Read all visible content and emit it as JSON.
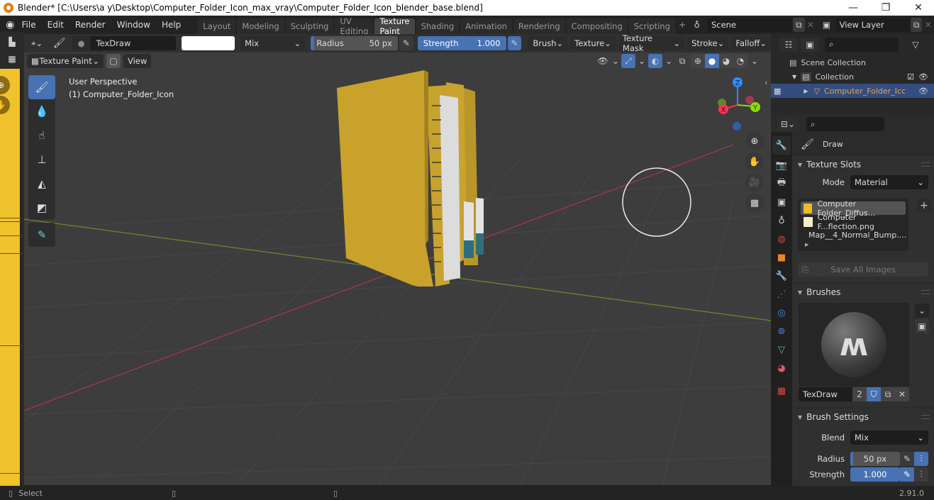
{
  "window": {
    "title": "Blender* [C:\\Users\\a y\\Desktop\\Computer_Folder_Icon_max_vray\\Computer_Folder_Icon_blender_base.blend]",
    "controls": {
      "minimize": "—",
      "maximize": "❐",
      "close": "✕"
    }
  },
  "menu": [
    "File",
    "Edit",
    "Render",
    "Window",
    "Help"
  ],
  "workspaces": [
    {
      "label": "Layout",
      "active": false
    },
    {
      "label": "Modeling",
      "active": false
    },
    {
      "label": "Sculpting",
      "active": false
    },
    {
      "label": "UV Editing",
      "active": false
    },
    {
      "label": "Texture Paint",
      "active": true
    },
    {
      "label": "Shading",
      "active": false
    },
    {
      "label": "Animation",
      "active": false
    },
    {
      "label": "Rendering",
      "active": false
    },
    {
      "label": "Compositing",
      "active": false
    },
    {
      "label": "Scripting",
      "active": false
    }
  ],
  "add_workspace": "+",
  "scene": {
    "label": "Scene"
  },
  "view_layer": {
    "label": "View Layer"
  },
  "tool_header": {
    "brush_name": "TexDraw",
    "color": "#ffffff",
    "blend": "Mix",
    "radius_label": "Radius",
    "radius_value": "50 px",
    "strength_label": "Strength",
    "strength_value": "1.000",
    "menus": [
      "Brush",
      "Texture",
      "Texture Mask",
      "Stroke",
      "Falloff"
    ]
  },
  "viewport_header": {
    "mode": "Texture Paint",
    "view": "View"
  },
  "viewport": {
    "perspective": "User Perspective",
    "object": "(1) Computer_Folder_Icon",
    "gizmo": {
      "x": "X",
      "y": "Y",
      "z": "Z"
    },
    "axis_colors": {
      "x": "#ff3352",
      "y": "#8bdc00",
      "z": "#2890ff"
    }
  },
  "outliner": {
    "scene_collection": "Scene Collection",
    "collection": "Collection",
    "object": "Computer_Folder_Icc"
  },
  "properties": {
    "tool_name": "Draw",
    "texture_slots": {
      "title": "Texture Slots",
      "mode_label": "Mode",
      "mode_value": "Material",
      "slots": [
        {
          "name": "Computer Folder_Diffus...",
          "color": "#e8be2a",
          "selected": true
        },
        {
          "name": "Computer F...flection.png",
          "color": "#f7ecc8",
          "selected": false
        },
        {
          "name": "Map__4_Normal_Bump....",
          "color": "#b9b6ff",
          "selected": false
        }
      ],
      "add": "+",
      "save_all": "Save All Images"
    },
    "brushes": {
      "title": "Brushes",
      "brush_name": "TexDraw",
      "users": "2"
    },
    "brush_settings": {
      "title": "Brush Settings",
      "blend_label": "Blend",
      "blend_value": "Mix",
      "radius_label": "Radius",
      "radius_value": "50 px",
      "strength_label": "Strength",
      "strength_value": "1.000"
    }
  },
  "statusbar": {
    "select": "Select",
    "version": "2.91.0"
  },
  "colors": {
    "accent": "#4772b3",
    "selected_row": "#334d80",
    "object_text": "#e3a552"
  }
}
